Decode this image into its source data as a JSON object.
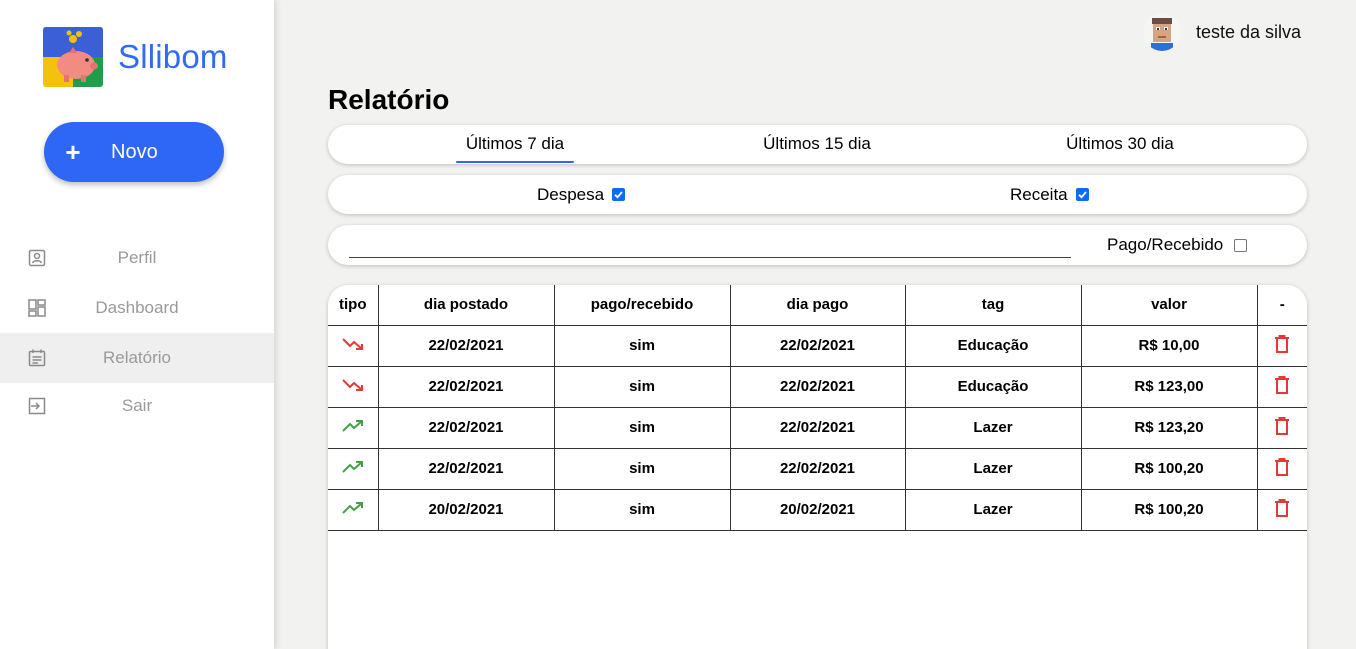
{
  "brand": {
    "name": "Sllibom"
  },
  "new_button": {
    "plus": "+",
    "label": "Novo"
  },
  "nav": [
    {
      "label": "Perfil",
      "icon": "user-card-icon"
    },
    {
      "label": "Dashboard",
      "icon": "dashboard-icon"
    },
    {
      "label": "Relatório",
      "icon": "report-icon",
      "active": true
    },
    {
      "label": "Sair",
      "icon": "logout-icon"
    }
  ],
  "user": {
    "name": "teste da silva"
  },
  "page": {
    "title": "Relatório"
  },
  "tabs": [
    {
      "label": "Últimos 7 dia",
      "active": true
    },
    {
      "label": "Últimos 15 dia"
    },
    {
      "label": "Últimos 30 dia"
    }
  ],
  "filters": {
    "despesa": {
      "label": "Despesa",
      "checked": true
    },
    "receita": {
      "label": "Receita",
      "checked": true
    }
  },
  "search": {
    "value": "",
    "placeholder": ""
  },
  "pago_filter": {
    "label": "Pago/Recebido",
    "checked": false
  },
  "table": {
    "headers": [
      "tipo",
      "dia postado",
      "pago/recebido",
      "dia pago",
      "tag",
      "valor",
      "-"
    ],
    "rows": [
      {
        "tipo": "despesa",
        "dia_postado": "22/02/2021",
        "pago": "sim",
        "dia_pago": "22/02/2021",
        "tag": "Educação",
        "valor": "R$ 10,00"
      },
      {
        "tipo": "despesa",
        "dia_postado": "22/02/2021",
        "pago": "sim",
        "dia_pago": "22/02/2021",
        "tag": "Educação",
        "valor": "R$ 123,00"
      },
      {
        "tipo": "receita",
        "dia_postado": "22/02/2021",
        "pago": "sim",
        "dia_pago": "22/02/2021",
        "tag": "Lazer",
        "valor": "R$ 123,20"
      },
      {
        "tipo": "receita",
        "dia_postado": "22/02/2021",
        "pago": "sim",
        "dia_pago": "22/02/2021",
        "tag": "Lazer",
        "valor": "R$ 100,20"
      },
      {
        "tipo": "receita",
        "dia_postado": "20/02/2021",
        "pago": "sim",
        "dia_pago": "20/02/2021",
        "tag": "Lazer",
        "valor": "R$ 100,20"
      }
    ]
  },
  "colors": {
    "accent": "#2e66f6",
    "expense": "#e53935",
    "income": "#43a047",
    "delete": "#e53935"
  }
}
